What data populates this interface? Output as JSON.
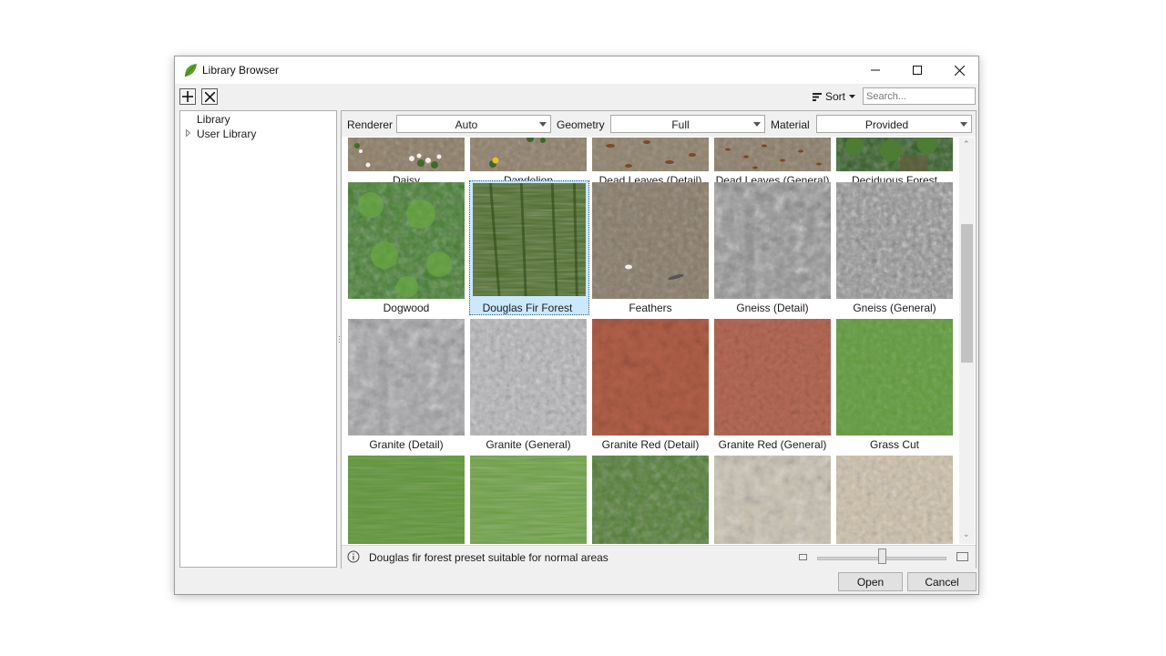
{
  "window": {
    "title": "Library Browser",
    "app_icon": "leaf-icon"
  },
  "toolbar": {
    "add_icon": "plus-icon",
    "remove_icon": "close-x-icon",
    "sort_label": "Sort",
    "search_placeholder": "Search..."
  },
  "tree": {
    "items": [
      "Library",
      "User Library"
    ]
  },
  "filters": {
    "renderer_label": "Renderer",
    "renderer_value": "Auto",
    "geometry_label": "Geometry",
    "geometry_value": "Full",
    "material_label": "Material",
    "material_value": "Provided"
  },
  "presets": [
    {
      "name": "Daisy"
    },
    {
      "name": "Dandelion"
    },
    {
      "name": "Dead Leaves (Detail)"
    },
    {
      "name": "Dead Leaves (General)"
    },
    {
      "name": "Deciduous Forest"
    },
    {
      "name": "Dogwood"
    },
    {
      "name": "Douglas Fir Forest",
      "selected": true
    },
    {
      "name": "Feathers"
    },
    {
      "name": "Gneiss (Detail)"
    },
    {
      "name": "Gneiss (General)"
    },
    {
      "name": "Granite (Detail)"
    },
    {
      "name": "Granite (General)"
    },
    {
      "name": "Granite Red (Detail)"
    },
    {
      "name": "Granite Red (General)"
    },
    {
      "name": "Grass Cut"
    },
    {
      "name": ""
    },
    {
      "name": ""
    },
    {
      "name": ""
    },
    {
      "name": ""
    },
    {
      "name": ""
    }
  ],
  "status": {
    "text": "Douglas fir forest preset suitable for normal areas",
    "thumbnail_zoom": 0.5
  },
  "buttons": {
    "open": "Open",
    "cancel": "Cancel"
  },
  "colors": {
    "selection": "#cce8ff",
    "leaf": "#5aa02c"
  }
}
